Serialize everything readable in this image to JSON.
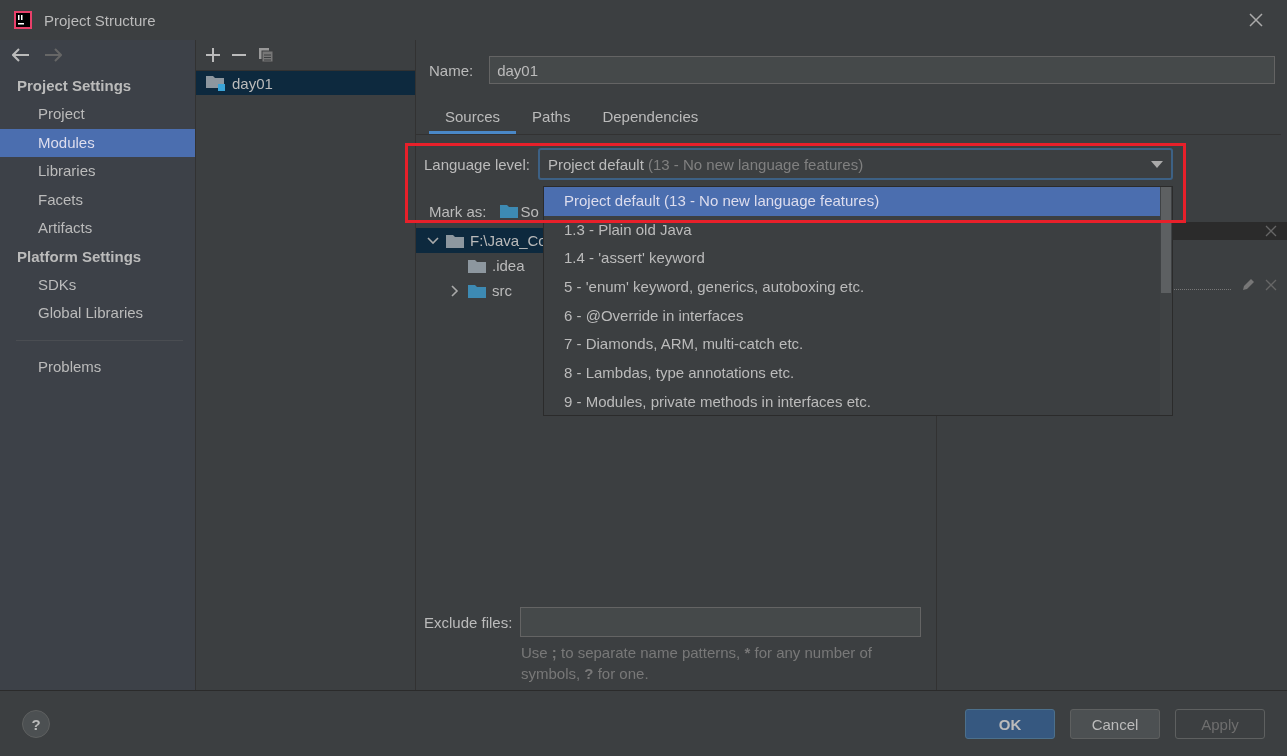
{
  "window": {
    "title": "Project Structure"
  },
  "sidebar": {
    "sections": [
      {
        "heading": "Project Settings",
        "items": [
          {
            "label": "Project",
            "selected": false
          },
          {
            "label": "Modules",
            "selected": true
          },
          {
            "label": "Libraries",
            "selected": false
          },
          {
            "label": "Facets",
            "selected": false
          },
          {
            "label": "Artifacts",
            "selected": false
          }
        ]
      },
      {
        "heading": "Platform Settings",
        "items": [
          {
            "label": "SDKs",
            "selected": false
          },
          {
            "label": "Global Libraries",
            "selected": false
          }
        ]
      }
    ],
    "footer_items": [
      {
        "label": "Problems",
        "selected": false
      }
    ]
  },
  "modules": [
    {
      "name": "day01",
      "selected": true
    }
  ],
  "name_field": {
    "label": "Name:",
    "value": "day01"
  },
  "tabs": [
    {
      "label": "Sources",
      "selected": true
    },
    {
      "label": "Paths",
      "selected": false
    },
    {
      "label": "Dependencies",
      "selected": false
    }
  ],
  "language_level": {
    "label": "Language level:",
    "value": "Project default",
    "value_detail": "(13 - No new language features)",
    "expanded": true,
    "options": [
      {
        "label": "Project default (13 - No new language features)",
        "selected": true
      },
      {
        "label": "1.3 - Plain old Java",
        "selected": false
      },
      {
        "label": "1.4 - 'assert' keyword",
        "selected": false
      },
      {
        "label": "5 - 'enum' keyword, generics, autoboxing etc.",
        "selected": false
      },
      {
        "label": "6 - @Override in interfaces",
        "selected": false
      },
      {
        "label": "7 - Diamonds, ARM, multi-catch etc.",
        "selected": false
      },
      {
        "label": "8 - Lambdas, type annotations etc.",
        "selected": false
      },
      {
        "label": "9 - Modules, private methods in interfaces etc.",
        "selected": false
      }
    ]
  },
  "mark_as": {
    "label": "Mark as:",
    "folders": [
      {
        "label": "So"
      }
    ]
  },
  "tree": [
    {
      "label": "F:\\Java_Co",
      "kind": "folder",
      "expanded": true,
      "selected": true,
      "children": [
        {
          "label": ".idea",
          "kind": "folder",
          "selected": false
        },
        {
          "label": "src",
          "kind": "source",
          "expanded": false,
          "selected": false
        }
      ]
    }
  ],
  "exclude_files": {
    "label": "Exclude files:",
    "hint": [
      {
        "text": "Use "
      },
      {
        "text": ";",
        "bold": true
      },
      {
        "text": " to separate name patterns, "
      },
      {
        "text": "*",
        "bold": true
      },
      {
        "text": " for any number of symbols, "
      },
      {
        "text": "?",
        "bold": true
      },
      {
        "text": " for one."
      }
    ]
  },
  "help": {
    "label": "?"
  },
  "buttons": [
    {
      "label": "OK",
      "kind": "default",
      "disabled": false
    },
    {
      "label": "Cancel",
      "kind": "normal",
      "disabled": false
    },
    {
      "label": "Apply",
      "kind": "normal",
      "disabled": true
    }
  ]
}
